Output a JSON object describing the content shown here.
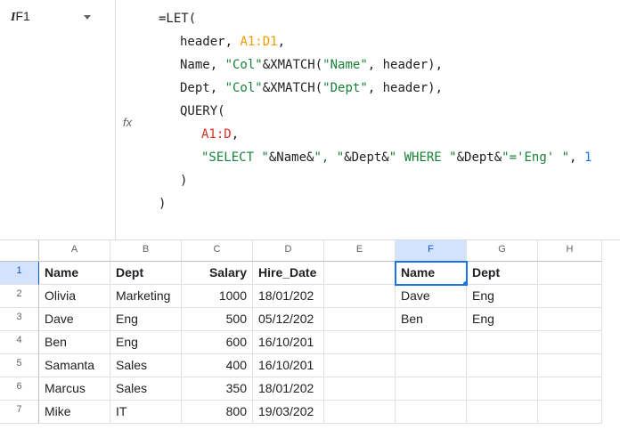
{
  "namebox": {
    "cell_ref": "F1",
    "cursor_glyph": "I"
  },
  "fx_label": "fx",
  "formula_lines": [
    {
      "indent": 0,
      "tokens": [
        {
          "t": "=LET(",
          "c": "kw"
        }
      ]
    },
    {
      "indent": 1,
      "tokens": [
        {
          "t": "header, ",
          "c": "kw"
        },
        {
          "t": "A1:D1",
          "c": "range2"
        },
        {
          "t": ",",
          "c": "kw"
        }
      ]
    },
    {
      "indent": 1,
      "tokens": [
        {
          "t": "Name, ",
          "c": "kw"
        },
        {
          "t": "\"Col\"",
          "c": "str"
        },
        {
          "t": "&XMATCH(",
          "c": "kw"
        },
        {
          "t": "\"Name\"",
          "c": "str"
        },
        {
          "t": ", header),",
          "c": "kw"
        }
      ]
    },
    {
      "indent": 1,
      "tokens": [
        {
          "t": "Dept, ",
          "c": "kw"
        },
        {
          "t": "\"Col\"",
          "c": "str"
        },
        {
          "t": "&XMATCH(",
          "c": "kw"
        },
        {
          "t": "\"Dept\"",
          "c": "str"
        },
        {
          "t": ", header),",
          "c": "kw"
        }
      ]
    },
    {
      "indent": 1,
      "tokens": [
        {
          "t": "QUERY(",
          "c": "kw"
        }
      ]
    },
    {
      "indent": 2,
      "tokens": [
        {
          "t": "A1:D",
          "c": "range"
        },
        {
          "t": ",",
          "c": "kw"
        }
      ]
    },
    {
      "indent": 2,
      "tokens": [
        {
          "t": "\"SELECT \"",
          "c": "str"
        },
        {
          "t": "&Name&",
          "c": "kw"
        },
        {
          "t": "\", \"",
          "c": "str"
        },
        {
          "t": "&Dept&",
          "c": "kw"
        },
        {
          "t": "\" WHERE \"",
          "c": "str"
        },
        {
          "t": "&Dept&",
          "c": "kw"
        },
        {
          "t": "\"='Eng' \"",
          "c": "str"
        },
        {
          "t": ", ",
          "c": "kw"
        },
        {
          "t": "1",
          "c": "num"
        }
      ]
    },
    {
      "indent": 1,
      "tokens": [
        {
          "t": ")",
          "c": "kw"
        }
      ]
    },
    {
      "indent": 0,
      "tokens": [
        {
          "t": ")",
          "c": "kw"
        }
      ]
    }
  ],
  "columns": [
    "A",
    "B",
    "C",
    "D",
    "E",
    "F",
    "G",
    "H"
  ],
  "rows": [
    1,
    2,
    3,
    4,
    5,
    6,
    7
  ],
  "selected_column": "F",
  "selected_row": 1,
  "cells": {
    "A1": {
      "v": "Name",
      "bold": true
    },
    "B1": {
      "v": "Dept",
      "bold": true
    },
    "C1": {
      "v": "Salary",
      "bold": true,
      "right": true
    },
    "D1": {
      "v": "Hire_Date",
      "bold": true
    },
    "F1": {
      "v": "Name",
      "bold": true,
      "selected": true
    },
    "G1": {
      "v": "Dept",
      "bold": true
    },
    "A2": {
      "v": "Olivia"
    },
    "B2": {
      "v": "Marketing"
    },
    "C2": {
      "v": "1000",
      "right": true
    },
    "D2": {
      "v": "18/01/202"
    },
    "F2": {
      "v": "Dave"
    },
    "G2": {
      "v": "Eng"
    },
    "A3": {
      "v": "Dave"
    },
    "B3": {
      "v": "Eng"
    },
    "C3": {
      "v": "500",
      "right": true
    },
    "D3": {
      "v": "05/12/202"
    },
    "F3": {
      "v": "Ben"
    },
    "G3": {
      "v": "Eng"
    },
    "A4": {
      "v": "Ben"
    },
    "B4": {
      "v": "Eng"
    },
    "C4": {
      "v": "600",
      "right": true
    },
    "D4": {
      "v": "16/10/201"
    },
    "A5": {
      "v": "Samanta"
    },
    "B5": {
      "v": "Sales"
    },
    "C5": {
      "v": "400",
      "right": true
    },
    "D5": {
      "v": "16/10/201"
    },
    "A6": {
      "v": "Marcus"
    },
    "B6": {
      "v": "Sales"
    },
    "C6": {
      "v": "350",
      "right": true
    },
    "D6": {
      "v": "18/01/202"
    },
    "A7": {
      "v": "Mike"
    },
    "B7": {
      "v": "IT"
    },
    "C7": {
      "v": "800",
      "right": true
    },
    "D7": {
      "v": "19/03/202"
    }
  }
}
